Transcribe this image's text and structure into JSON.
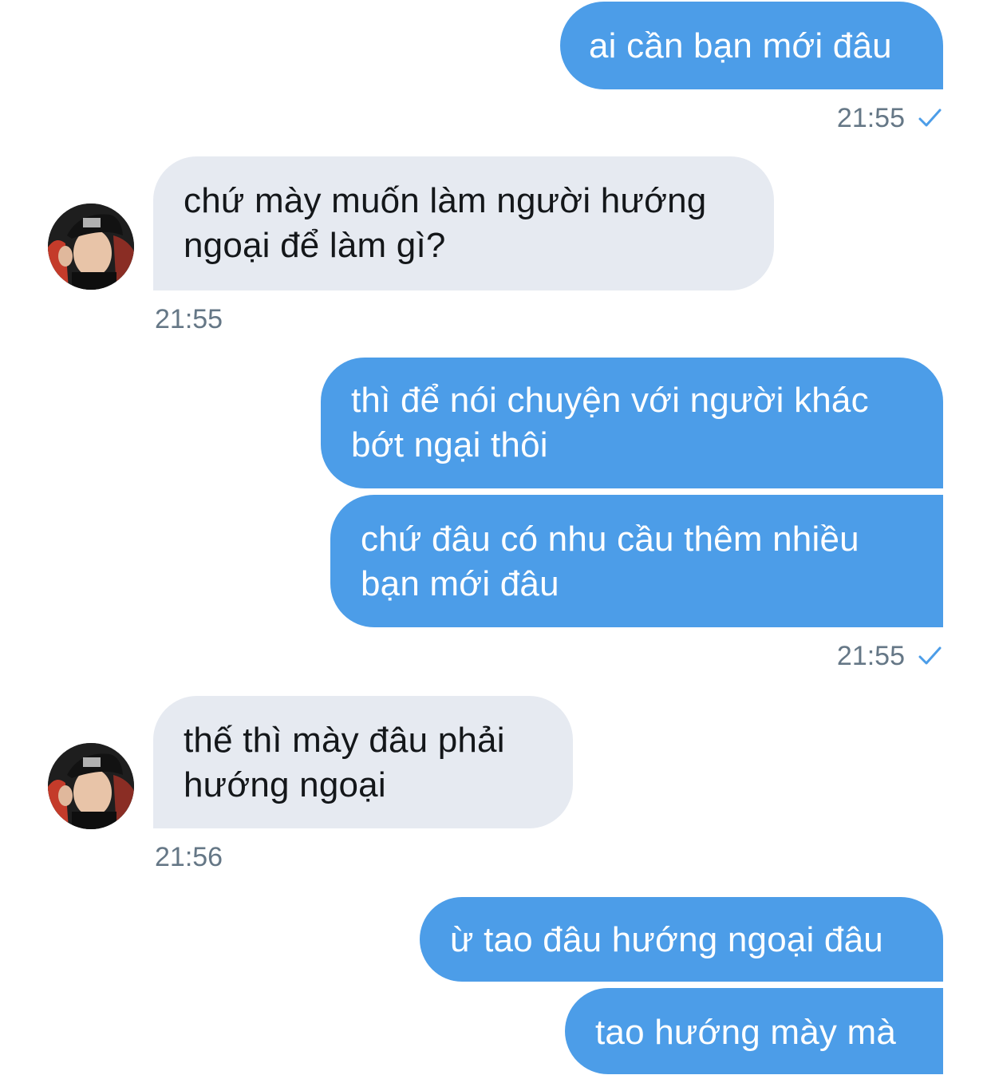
{
  "colors": {
    "outgoing_bubble": "#4c9de8",
    "incoming_bubble": "#e6eaf1",
    "timestamp": "#657786",
    "read_check": "#4c9de8"
  },
  "messages": [
    {
      "direction": "out",
      "text": "ai cần bạn mới đâu"
    },
    {
      "direction": "out_time",
      "time": "21:55",
      "icon": "check-icon"
    },
    {
      "direction": "in",
      "line1": "chứ mày muốn làm người hướng",
      "line2": "ngoại để làm gì?"
    },
    {
      "direction": "in_time",
      "time": "21:55"
    },
    {
      "direction": "out",
      "line1": "thì để nói chuyện với người khác",
      "line2": "bớt ngại thôi"
    },
    {
      "direction": "out",
      "line1": "chứ đâu có nhu cầu thêm nhiều",
      "line2": "bạn mới đâu"
    },
    {
      "direction": "out_time",
      "time": "21:55",
      "icon": "check-icon"
    },
    {
      "direction": "in",
      "line1": "thế thì mày đâu phải",
      "line2": "hướng ngoại"
    },
    {
      "direction": "in_time",
      "time": "21:56"
    },
    {
      "direction": "out",
      "text": "ừ tao đâu hướng ngoại đâu"
    },
    {
      "direction": "out",
      "text": "tao hướng mày mà"
    }
  ]
}
